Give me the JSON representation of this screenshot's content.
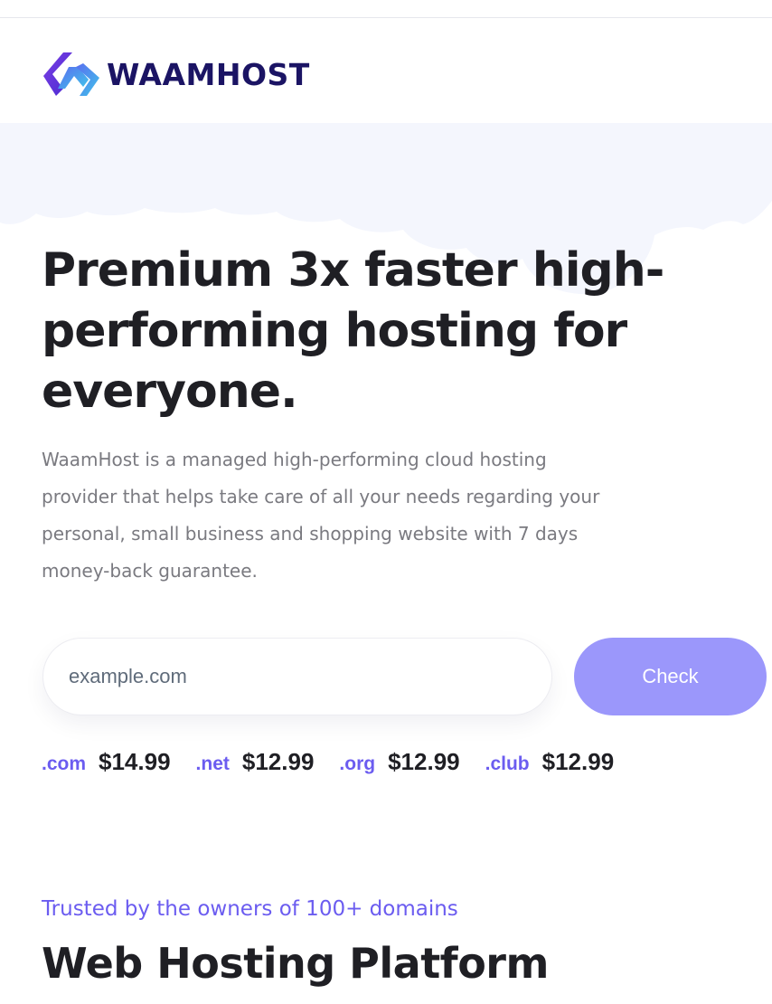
{
  "brand": {
    "name": "WAAMHOST",
    "logo_icon": "waamhost-logo-icon",
    "colors": {
      "primary": "#1b1464",
      "accent_violet": "#6b5cf0",
      "accent_cyan": "#3fb9e6"
    }
  },
  "hero": {
    "title": "Premium 3x faster high-performing hosting for everyone.",
    "description": "WaamHost is a managed high-performing cloud hosting provider that helps take care of all your needs regarding your personal, small business and shopping website with 7 days money-back guarantee.",
    "background_color": "#f4f6fd"
  },
  "domain_search": {
    "placeholder": "example.com",
    "value": "",
    "button_label": "Check",
    "button_color": "#9b97fb"
  },
  "prices": [
    {
      "ext": ".com",
      "price": "$14.99"
    },
    {
      "ext": ".net",
      "price": "$12.99"
    },
    {
      "ext": ".org",
      "price": "$12.99"
    },
    {
      "ext": ".club",
      "price": "$12.99"
    }
  ],
  "platform": {
    "eyebrow": "Trusted by the owners of 100+ domains",
    "title": "Web Hosting Platform"
  }
}
